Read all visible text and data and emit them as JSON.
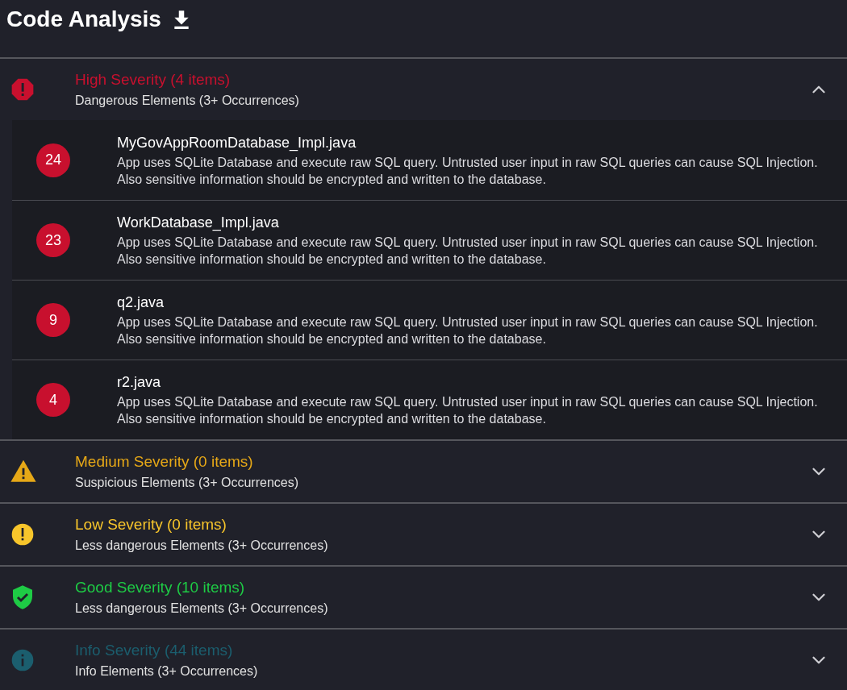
{
  "title": "Code Analysis",
  "sections": [
    {
      "kind": "high",
      "color": "#c8102e",
      "title": "High Severity (4 items)",
      "subtitle": "Dangerous Elements (3+ Occurrences)",
      "expanded": true,
      "items": [
        {
          "count": "24",
          "file": "MyGovAppRoomDatabase_Impl.java",
          "description": "App uses SQLite Database and execute raw SQL query. Untrusted user input in raw SQL queries can cause SQL Injection. Also sensitive information should be encrypted and written to the database."
        },
        {
          "count": "23",
          "file": "WorkDatabase_Impl.java",
          "description": "App uses SQLite Database and execute raw SQL query. Untrusted user input in raw SQL queries can cause SQL Injection. Also sensitive information should be encrypted and written to the database."
        },
        {
          "count": "9",
          "file": "q2.java",
          "description": "App uses SQLite Database and execute raw SQL query. Untrusted user input in raw SQL queries can cause SQL Injection. Also sensitive information should be encrypted and written to the database."
        },
        {
          "count": "4",
          "file": "r2.java",
          "description": "App uses SQLite Database and execute raw SQL query. Untrusted user input in raw SQL queries can cause SQL Injection. Also sensitive information should be encrypted and written to the database."
        }
      ]
    },
    {
      "kind": "medium",
      "color": "#e6a817",
      "title": "Medium Severity (0 items)",
      "subtitle": "Suspicious Elements (3+ Occurrences)",
      "expanded": false
    },
    {
      "kind": "low",
      "color": "#f7c52b",
      "title": "Low Severity (0 items)",
      "subtitle": "Less dangerous Elements (3+ Occurrences)",
      "expanded": false
    },
    {
      "kind": "good",
      "color": "#1ecb45",
      "title": "Good Severity (10 items)",
      "subtitle": "Less dangerous Elements (3+ Occurrences)",
      "expanded": false
    },
    {
      "kind": "info",
      "color": "#1b5e6e",
      "title": "Info Severity (44 items)",
      "subtitle": "Info Elements (3+ Occurrences)",
      "expanded": false
    }
  ]
}
